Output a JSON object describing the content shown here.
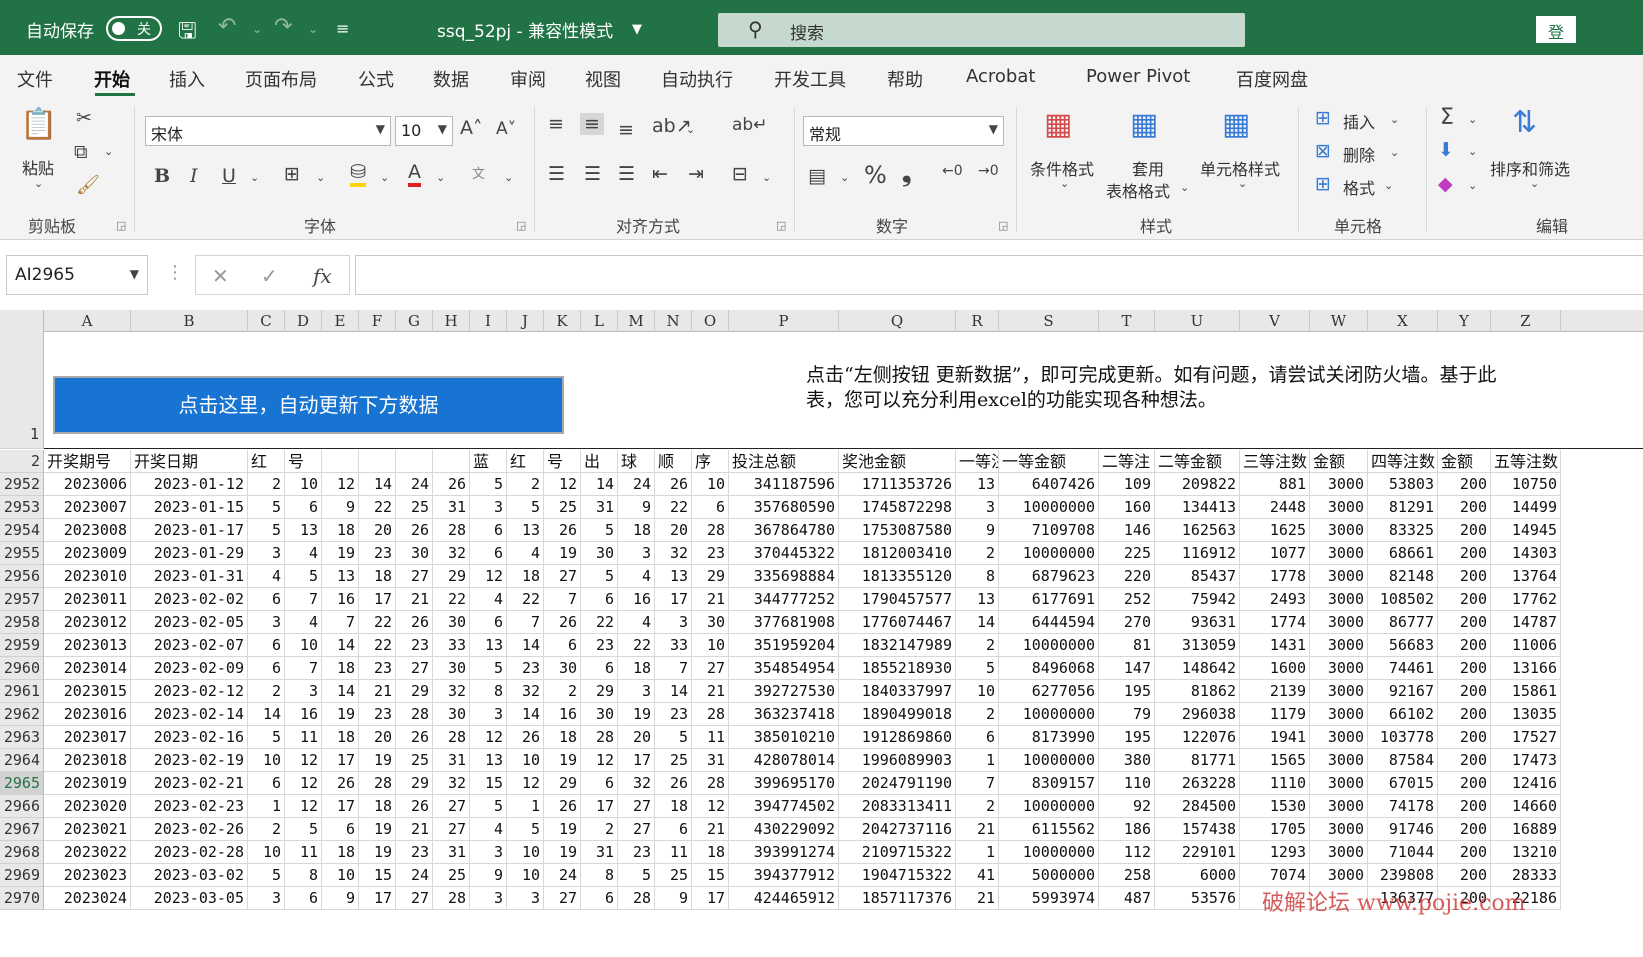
{
  "titlebar": {
    "autosave_label": "自动保存",
    "autosave_state": "关",
    "doc_title": "ssq_52pj  -  兼容性模式",
    "search_placeholder": "搜索",
    "login_label": "登"
  },
  "menu": {
    "tabs": [
      "文件",
      "开始",
      "插入",
      "页面布局",
      "公式",
      "数据",
      "审阅",
      "视图",
      "自动执行",
      "开发工具",
      "帮助",
      "Acrobat",
      "Power Pivot",
      "百度网盘"
    ],
    "active": "开始"
  },
  "ribbon": {
    "clipboard": {
      "paste": "粘贴",
      "group": "剪贴板"
    },
    "font": {
      "name": "宋体",
      "size": "10",
      "bold": "B",
      "italic": "I",
      "underline": "U",
      "color_letter": "A",
      "group": "字体"
    },
    "alignment": {
      "group": "对齐方式"
    },
    "number": {
      "format": "常规",
      "percent": "%",
      "comma": "❟",
      "group": "数字"
    },
    "styles": {
      "cond": "条件格式",
      "table_1": "套用",
      "table_2": "表格格式",
      "cell": "单元格样式",
      "group": "样式"
    },
    "cells": {
      "insert": "插入",
      "delete": "删除",
      "format": "格式",
      "group": "单元格"
    },
    "editing": {
      "sort": "排序和筛选",
      "group": "编辑"
    },
    "accent": "#217346"
  },
  "formula": {
    "namebox": "AI2965",
    "fx": "fx",
    "value": ""
  },
  "sheet": {
    "columns": [
      "A",
      "B",
      "C",
      "D",
      "E",
      "F",
      "G",
      "H",
      "I",
      "J",
      "K",
      "L",
      "M",
      "N",
      "O",
      "P",
      "Q",
      "R",
      "S",
      "T",
      "U",
      "V",
      "W",
      "X",
      "Y",
      "Z"
    ],
    "update_button": "点击这里，自动更新下方数据",
    "note": "点击“左侧按钮 更新数据”，即可完成更新。如有问题，请尝试关闭防火墙。基于此表，您可以充分利用excel的功能实现各种想法。",
    "header_row_number": "2",
    "header": [
      "开奖期号",
      "开奖日期",
      "红",
      "号",
      "",
      "",
      "",
      "",
      "蓝",
      "红",
      "号",
      "出",
      "球",
      "顺",
      "序",
      "投注总额",
      "奖池金额",
      "一等注",
      "一等金额",
      "二等注",
      "二等金额",
      "三等注数",
      "金额",
      "四等注数",
      "金额",
      "五等注数"
    ],
    "selected_row": "2965",
    "rows": [
      {
        "n": "2952",
        "c": [
          "2023006",
          "2023-01-12",
          "2",
          "10",
          "12",
          "14",
          "24",
          "26",
          "5",
          "2",
          "12",
          "14",
          "24",
          "26",
          "10",
          "341187596",
          "1711353726",
          "13",
          "6407426",
          "109",
          "209822",
          "881",
          "3000",
          "53803",
          "200",
          "10750"
        ]
      },
      {
        "n": "2953",
        "c": [
          "2023007",
          "2023-01-15",
          "5",
          "6",
          "9",
          "22",
          "25",
          "31",
          "3",
          "5",
          "25",
          "31",
          "9",
          "22",
          "6",
          "357680590",
          "1745872298",
          "3",
          "10000000",
          "160",
          "134413",
          "2448",
          "3000",
          "81291",
          "200",
          "14499"
        ]
      },
      {
        "n": "2954",
        "c": [
          "2023008",
          "2023-01-17",
          "5",
          "13",
          "18",
          "20",
          "26",
          "28",
          "6",
          "13",
          "26",
          "5",
          "18",
          "20",
          "28",
          "367864780",
          "1753087580",
          "9",
          "7109708",
          "146",
          "162563",
          "1625",
          "3000",
          "83325",
          "200",
          "14945"
        ]
      },
      {
        "n": "2955",
        "c": [
          "2023009",
          "2023-01-29",
          "3",
          "4",
          "19",
          "23",
          "30",
          "32",
          "6",
          "4",
          "19",
          "30",
          "3",
          "32",
          "23",
          "370445322",
          "1812003410",
          "2",
          "10000000",
          "225",
          "116912",
          "1077",
          "3000",
          "68661",
          "200",
          "14303"
        ]
      },
      {
        "n": "2956",
        "c": [
          "2023010",
          "2023-01-31",
          "4",
          "5",
          "13",
          "18",
          "27",
          "29",
          "12",
          "18",
          "27",
          "5",
          "4",
          "13",
          "29",
          "335698884",
          "1813355120",
          "8",
          "6879623",
          "220",
          "85437",
          "1778",
          "3000",
          "82148",
          "200",
          "13764"
        ]
      },
      {
        "n": "2957",
        "c": [
          "2023011",
          "2023-02-02",
          "6",
          "7",
          "16",
          "17",
          "21",
          "22",
          "4",
          "22",
          "7",
          "6",
          "16",
          "17",
          "21",
          "344777252",
          "1790457577",
          "13",
          "6177691",
          "252",
          "75942",
          "2493",
          "3000",
          "108502",
          "200",
          "17762"
        ]
      },
      {
        "n": "2958",
        "c": [
          "2023012",
          "2023-02-05",
          "3",
          "4",
          "7",
          "22",
          "26",
          "30",
          "6",
          "7",
          "26",
          "22",
          "4",
          "3",
          "30",
          "377681908",
          "1776074467",
          "14",
          "6444594",
          "270",
          "93631",
          "1774",
          "3000",
          "86777",
          "200",
          "14787"
        ]
      },
      {
        "n": "2959",
        "c": [
          "2023013",
          "2023-02-07",
          "6",
          "10",
          "14",
          "22",
          "23",
          "33",
          "13",
          "14",
          "6",
          "23",
          "22",
          "33",
          "10",
          "351959204",
          "1832147989",
          "2",
          "10000000",
          "81",
          "313059",
          "1431",
          "3000",
          "56683",
          "200",
          "11006"
        ]
      },
      {
        "n": "2960",
        "c": [
          "2023014",
          "2023-02-09",
          "6",
          "7",
          "18",
          "23",
          "27",
          "30",
          "5",
          "23",
          "30",
          "6",
          "18",
          "7",
          "27",
          "354854954",
          "1855218930",
          "5",
          "8496068",
          "147",
          "148642",
          "1600",
          "3000",
          "74461",
          "200",
          "13166"
        ]
      },
      {
        "n": "2961",
        "c": [
          "2023015",
          "2023-02-12",
          "2",
          "3",
          "14",
          "21",
          "29",
          "32",
          "8",
          "32",
          "2",
          "29",
          "3",
          "14",
          "21",
          "392727530",
          "1840337997",
          "10",
          "6277056",
          "195",
          "81862",
          "2139",
          "3000",
          "92167",
          "200",
          "15861"
        ]
      },
      {
        "n": "2962",
        "c": [
          "2023016",
          "2023-02-14",
          "14",
          "16",
          "19",
          "23",
          "28",
          "30",
          "3",
          "14",
          "16",
          "30",
          "19",
          "23",
          "28",
          "363237418",
          "1890499018",
          "2",
          "10000000",
          "79",
          "296038",
          "1179",
          "3000",
          "66102",
          "200",
          "13035"
        ]
      },
      {
        "n": "2963",
        "c": [
          "2023017",
          "2023-02-16",
          "5",
          "11",
          "18",
          "20",
          "26",
          "28",
          "12",
          "26",
          "18",
          "28",
          "20",
          "5",
          "11",
          "385010210",
          "1912869860",
          "6",
          "8173990",
          "195",
          "122076",
          "1941",
          "3000",
          "103778",
          "200",
          "17527"
        ]
      },
      {
        "n": "2964",
        "c": [
          "2023018",
          "2023-02-19",
          "10",
          "12",
          "17",
          "19",
          "25",
          "31",
          "13",
          "10",
          "19",
          "12",
          "17",
          "25",
          "31",
          "428078014",
          "1996089903",
          "1",
          "10000000",
          "380",
          "81771",
          "1565",
          "3000",
          "87584",
          "200",
          "17473"
        ]
      },
      {
        "n": "2965",
        "c": [
          "2023019",
          "2023-02-21",
          "6",
          "12",
          "26",
          "28",
          "29",
          "32",
          "15",
          "12",
          "29",
          "6",
          "32",
          "26",
          "28",
          "399695170",
          "2024791190",
          "7",
          "8309157",
          "110",
          "263228",
          "1110",
          "3000",
          "67015",
          "200",
          "12416"
        ]
      },
      {
        "n": "2966",
        "c": [
          "2023020",
          "2023-02-23",
          "1",
          "12",
          "17",
          "18",
          "26",
          "27",
          "5",
          "1",
          "26",
          "17",
          "27",
          "18",
          "12",
          "394774502",
          "2083313411",
          "2",
          "10000000",
          "92",
          "284500",
          "1530",
          "3000",
          "74178",
          "200",
          "14660"
        ]
      },
      {
        "n": "2967",
        "c": [
          "2023021",
          "2023-02-26",
          "2",
          "5",
          "6",
          "19",
          "21",
          "27",
          "4",
          "5",
          "19",
          "2",
          "27",
          "6",
          "21",
          "430229092",
          "2042737116",
          "21",
          "6115562",
          "186",
          "157438",
          "1705",
          "3000",
          "91746",
          "200",
          "16889"
        ]
      },
      {
        "n": "2968",
        "c": [
          "2023022",
          "2023-02-28",
          "10",
          "11",
          "18",
          "19",
          "23",
          "31",
          "3",
          "10",
          "19",
          "31",
          "23",
          "11",
          "18",
          "393991274",
          "2109715322",
          "1",
          "10000000",
          "112",
          "229101",
          "1293",
          "3000",
          "71044",
          "200",
          "13210"
        ]
      },
      {
        "n": "2969",
        "c": [
          "2023023",
          "2023-03-02",
          "5",
          "8",
          "10",
          "15",
          "24",
          "25",
          "9",
          "10",
          "24",
          "8",
          "5",
          "25",
          "15",
          "394377912",
          "1904715322",
          "41",
          "5000000",
          "258",
          "6000",
          "7074",
          "3000",
          "239808",
          "200",
          "28333"
        ]
      },
      {
        "n": "2970",
        "c": [
          "2023024",
          "2023-03-05",
          "3",
          "6",
          "9",
          "17",
          "27",
          "28",
          "3",
          "3",
          "27",
          "6",
          "28",
          "9",
          "17",
          "424465912",
          "1857117376",
          "21",
          "5993974",
          "487",
          "53576",
          "",
          "",
          "136377",
          "200",
          "22186"
        ]
      }
    ]
  },
  "watermark": "破解论坛 www.pojie.com"
}
